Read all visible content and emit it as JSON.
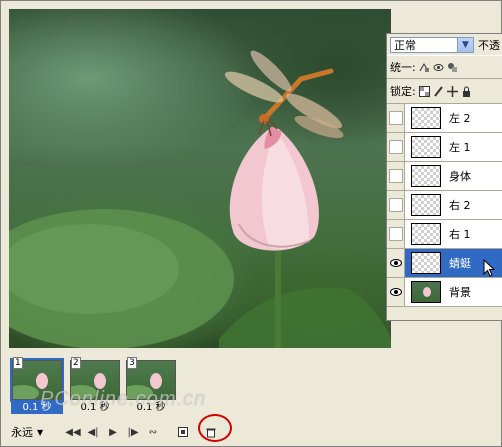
{
  "layers_panel": {
    "blend_mode": "正常",
    "opacity_label": "不透",
    "unify_label": "统一:",
    "lock_label": "锁定:",
    "layers": [
      {
        "name": "左 2",
        "visible": false,
        "selected": false,
        "thumb": "transparent"
      },
      {
        "name": "左 1",
        "visible": false,
        "selected": false,
        "thumb": "transparent"
      },
      {
        "name": "身体",
        "visible": false,
        "selected": false,
        "thumb": "transparent"
      },
      {
        "name": "右 2",
        "visible": false,
        "selected": false,
        "thumb": "transparent"
      },
      {
        "name": "右 1",
        "visible": false,
        "selected": false,
        "thumb": "transparent"
      },
      {
        "name": "蜻蜓",
        "visible": true,
        "selected": true,
        "thumb": "transparent"
      },
      {
        "name": "背景",
        "visible": true,
        "selected": false,
        "thumb": "photo"
      }
    ]
  },
  "animation": {
    "frames": [
      {
        "number": "1",
        "delay": "0.1 秒",
        "selected": true
      },
      {
        "number": "2",
        "delay": "0.1 秒",
        "selected": false
      },
      {
        "number": "3",
        "delay": "0.1 秒",
        "selected": false
      }
    ],
    "loop_option": "永远"
  },
  "watermark": "PConline.com.cn",
  "colors": {
    "selection": "#316ac5",
    "highlight_ring": "#d40000"
  }
}
